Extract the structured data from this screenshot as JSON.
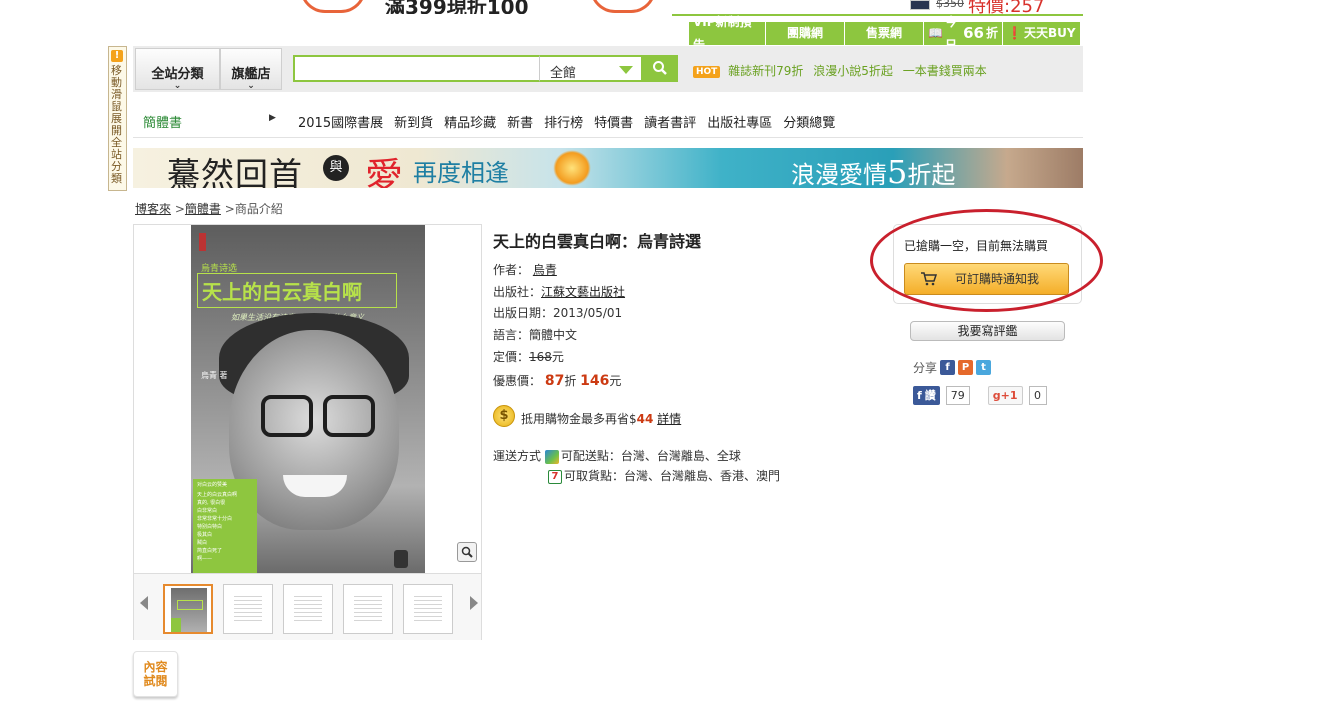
{
  "top_banner": {
    "text": "滿399現折100"
  },
  "top_promo": {
    "old_price": "$350",
    "price": "特價:257"
  },
  "green_tabs": [
    {
      "label": "VIP新制預告"
    },
    {
      "label": "團購網"
    },
    {
      "label": "售票網"
    },
    {
      "label_prefix": "今日",
      "number": "66",
      "label_suffix": "折"
    },
    {
      "label": "天天BUY"
    }
  ],
  "side_bar": {
    "text": "移動滑鼠展開全站分類"
  },
  "header": {
    "all_categories": "全站分類",
    "flagship": "旗艦店",
    "search_placeholder": "",
    "scope": "全館",
    "hot_badge": "HOT",
    "hot_links": [
      "雜誌新刊79折",
      "浪漫小說5折起",
      "一本書錢買兩本"
    ]
  },
  "cat_nav": {
    "current": "簡體書",
    "links": [
      "2015國際書展",
      "新到貨",
      "精品珍藏",
      "新書",
      "排行榜",
      "特價書",
      "讀者書評",
      "出版社專區",
      "分類總覽"
    ]
  },
  "ad_banner": {
    "t1": "驀然回首",
    "yu": "與",
    "ai": "愛",
    "t2": "再度相逢",
    "t3_prefix": "浪漫愛情",
    "t3_num": "5",
    "t3_suffix": "折起"
  },
  "breadcrumb": {
    "home": "博客來",
    "sep": ">",
    "section": "簡體書",
    "current": "商品介紹"
  },
  "cover": {
    "small_title": "烏青诗选",
    "big_title": "天上的白云真白啊",
    "subtitle": "如果生活没有诗意, 活着还有什么意义",
    "author": "烏青 著",
    "box_lines": [
      "对白云的赞美",
      "天上的白云真白啊",
      "真的, 很白很",
      "白非常白",
      "非常非常十分白",
      "特别白特白",
      "极其白",
      "贼白",
      "简直白死了",
      "啊——"
    ]
  },
  "preview": {
    "line1": "內容",
    "line2": "試閱"
  },
  "product": {
    "title": "天上的白雲真白啊：烏青詩選",
    "author_label": "作者：",
    "author": "烏青",
    "publisher_label": "出版社：",
    "publisher": "江蘇文藝出版社",
    "date_label": "出版日期：",
    "date": "2013/05/01",
    "lang_label": "語言：",
    "lang": "簡體中文",
    "list_price_label": "定價：",
    "list_price": "168",
    "list_price_unit": "元",
    "sale_label": "優惠價：",
    "discount": "87",
    "discount_unit": "折",
    "sale_price": "146",
    "sale_unit": "元",
    "coin_symbol": "$",
    "cashback_text": "抵用購物金最多再省$",
    "cashback_amount": "44",
    "cashback_link": "詳情",
    "shipping_label": "運送方式",
    "delivery": "可配送點：台灣、台灣離島、全球",
    "pickup": "可取貨點：台灣、台灣離島、香港、澳門"
  },
  "buy_box": {
    "sold_out": "已搶購一空，目前無法購買",
    "notify": "可訂購時通知我"
  },
  "review_btn": "我要寫評鑑",
  "share": {
    "label": "分享",
    "fb_like": "讚",
    "fb_count": "79",
    "gplus": "+1",
    "gplus_count": "0"
  },
  "colors": {
    "brand_green": "#8dc63f",
    "price_red": "#cc3a12",
    "annotation_red": "#c9202d",
    "button_orange": "#f4ae29"
  }
}
